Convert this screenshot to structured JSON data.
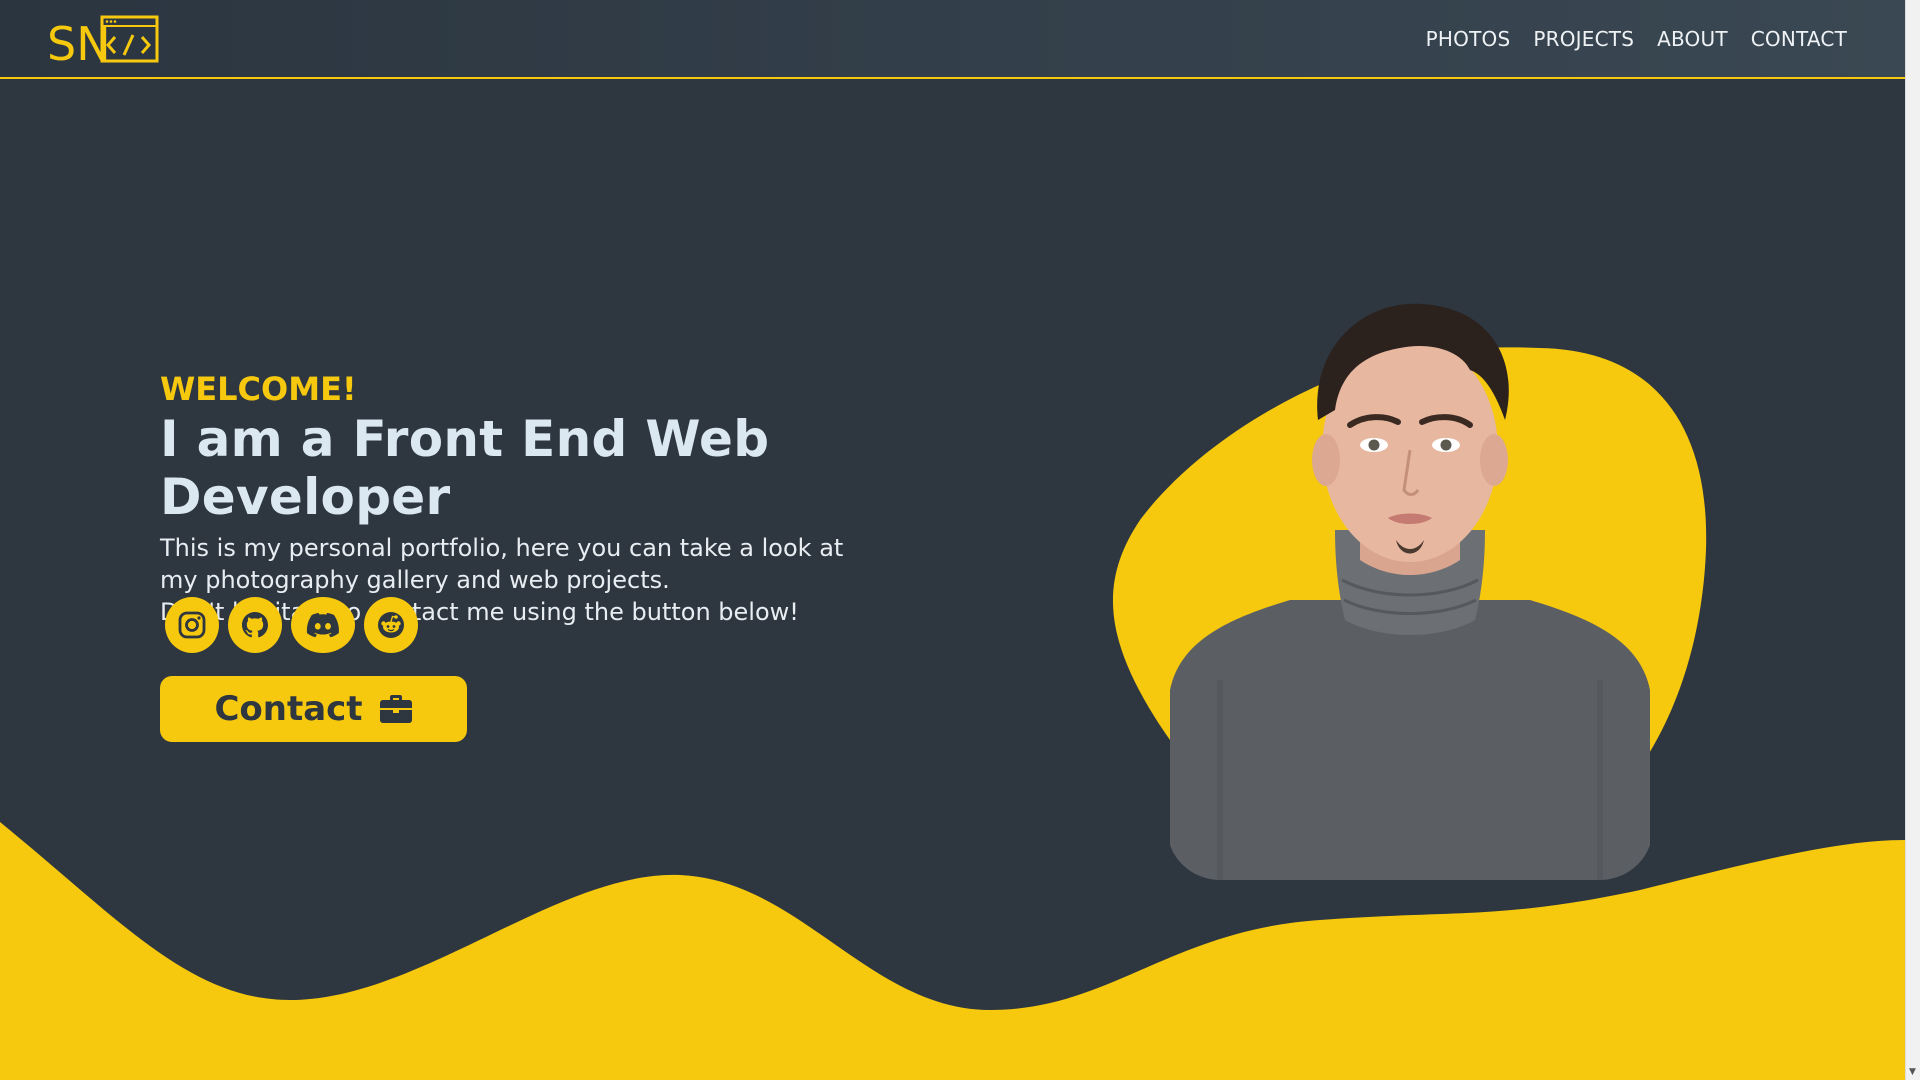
{
  "header": {
    "logo_text": "SN",
    "nav": [
      "PHOTOS",
      "PROJECTS",
      "ABOUT",
      "CONTACT"
    ]
  },
  "hero": {
    "welcome": "WELCOME!",
    "headline": "I am a Front End Web Developer",
    "description_line1": "This is my personal portfolio, here you can take a look at my photography gallery and web projects.",
    "description_line2": "Don't hesitate to contact me using the button below!",
    "contact_label": "Contact"
  },
  "socials": [
    "instagram-icon",
    "github-icon",
    "discord-icon",
    "reddit-icon"
  ],
  "colors": {
    "background": "#2e3640",
    "accent": "#f6c90e",
    "headline": "#dbe8f2",
    "text": "#e8edf1"
  }
}
